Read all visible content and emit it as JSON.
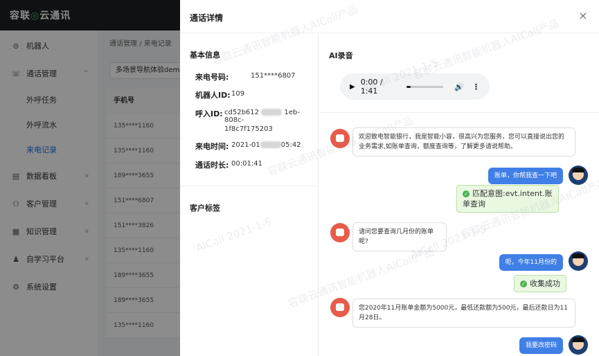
{
  "app": {
    "logo_text": "容联",
    "logo_text2": "云通讯"
  },
  "sidebar": {
    "items": [
      {
        "label": "机器人",
        "icon": "robot-icon"
      },
      {
        "label": "通话管理",
        "icon": "phone-icon"
      },
      {
        "label": "数据看板",
        "icon": "chart-icon"
      },
      {
        "label": "客户管理",
        "icon": "users-icon"
      },
      {
        "label": "知识管理",
        "icon": "book-icon"
      },
      {
        "label": "自学习平台",
        "icon": "learn-icon"
      },
      {
        "label": "系统设置",
        "icon": "settings-icon"
      }
    ],
    "sub_items": [
      {
        "label": "外呼任务"
      },
      {
        "label": "外呼流水"
      },
      {
        "label": "来电记录"
      }
    ]
  },
  "main": {
    "breadcrumb": "通话管理 / 来电记录",
    "filter_value": "多场景导航体验demo",
    "table_header": "手机号",
    "rows": [
      "135****1160",
      "135****1160",
      "189****3655",
      "151****6807",
      "151****3826",
      "135****1160",
      "189****3655",
      "189****3655",
      "135****1160"
    ]
  },
  "drawer": {
    "title": "通话详情",
    "close_symbol": "×",
    "basic_info_title": "基本信息",
    "fields": {
      "caller_label": "来电号码:",
      "caller_value": "151****6807",
      "robot_label": "机器人ID:",
      "robot_value": "109",
      "call_id_label": "呼入ID:",
      "call_id_part1": "cd52b612",
      "call_id_part2": "1eb-808c-",
      "call_id_line2": "1f8c7f175203",
      "time_label": "来电时间:",
      "time_part1": "2021-01",
      "time_part2": "05:42",
      "duration_label": "通话时长:",
      "duration_value": "00:01:41"
    },
    "tags_title": "客户标签",
    "ai_title": "AI录音",
    "audio": {
      "time": "0:00 / 1:41",
      "progress": 0.1
    },
    "messages": [
      {
        "role": "bot",
        "text": "欢迎致电智能银行，我是智能小容，很高兴为您服务，您可以直接说出您的业务需求,如账单查询，额度查询等，了解更多请说帮助。"
      },
      {
        "role": "user",
        "text": "账单，你帮我查一下吧"
      },
      {
        "role": "intent",
        "text": "匹配意图:evt.intent.账单查询"
      },
      {
        "role": "bot",
        "text": "请问您要查询几月份的账单呢?"
      },
      {
        "role": "user",
        "text": "呃，今年11月份的"
      },
      {
        "role": "intent",
        "text": "收集成功"
      },
      {
        "role": "bot",
        "text": "您2020年11月账单金额为5000元，最低还款额为500元，最后还款日为11月28日。"
      },
      {
        "role": "user",
        "text": "我要改密码"
      }
    ]
  },
  "watermark": {
    "text": "容联云通讯智能机器人AICall产品",
    "date": "AICall 2021-1-5"
  },
  "colors": {
    "accent": "#1a6fe8",
    "user_bubble": "#3f7fe6",
    "bot_avatar": "#e85c4a",
    "intent_bg": "#eaf8e2",
    "topbar": "#1c1f24"
  }
}
